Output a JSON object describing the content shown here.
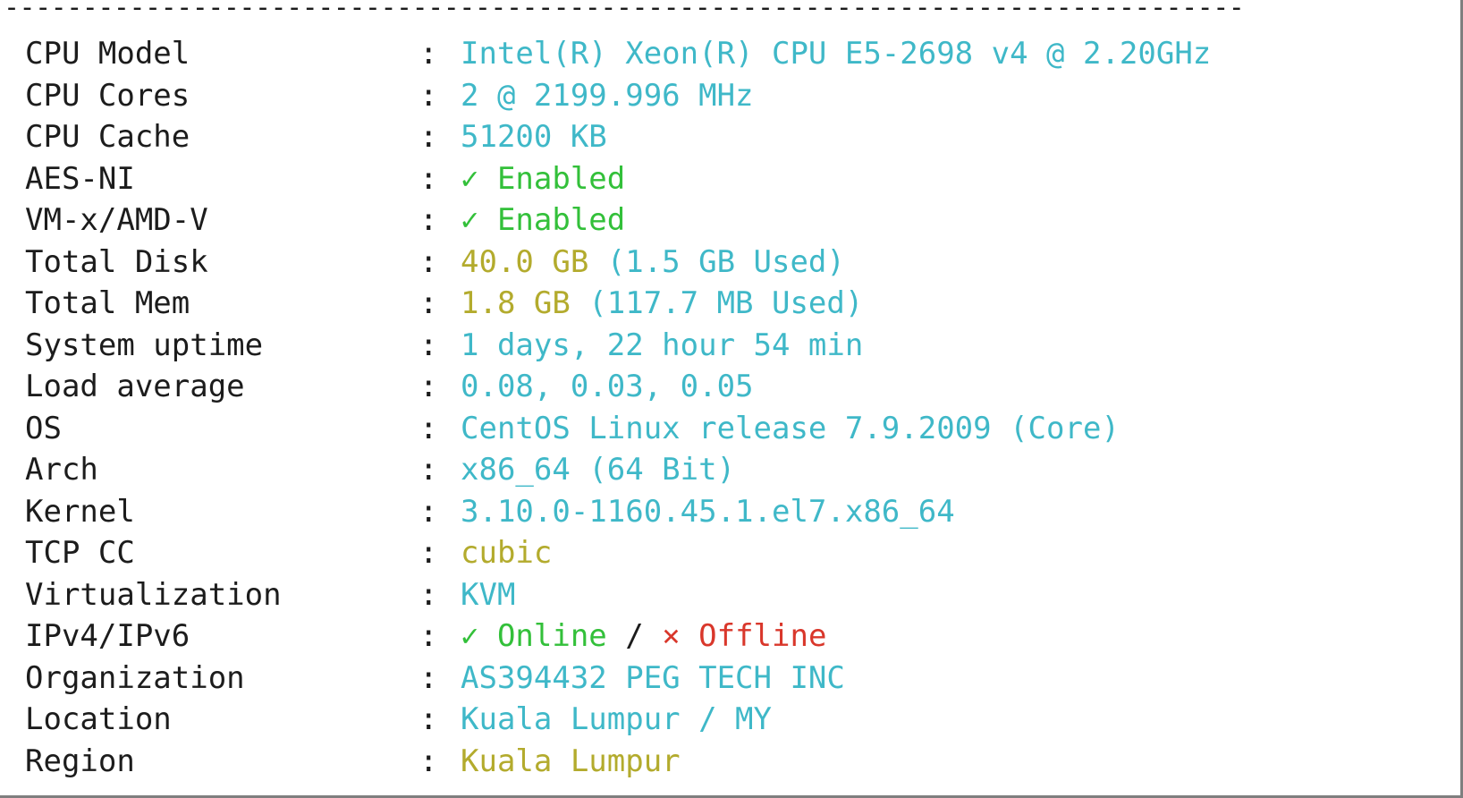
{
  "colors": {
    "label": "#1c1c1c",
    "cyan": "#3fb8c8",
    "green": "#33c03a",
    "yellow": "#b3ab2d",
    "red": "#d9372b",
    "plain": "#1c1c1c"
  },
  "separator": "-------------------------------------------------------------------------------",
  "rows": [
    {
      "label": "CPU Model",
      "colon": ":",
      "segments": [
        {
          "text": "Intel(R) Xeon(R) CPU E5-2698 v4 @ 2.20GHz",
          "color": "cyan"
        }
      ]
    },
    {
      "label": "CPU Cores",
      "colon": ":",
      "segments": [
        {
          "text": "2 @ 2199.996 MHz",
          "color": "cyan"
        }
      ]
    },
    {
      "label": "CPU Cache",
      "colon": ":",
      "segments": [
        {
          "text": "51200 KB",
          "color": "cyan"
        }
      ]
    },
    {
      "label": "AES-NI",
      "colon": ":",
      "segments": [
        {
          "text": "✓ Enabled",
          "color": "green"
        }
      ]
    },
    {
      "label": "VM-x/AMD-V",
      "colon": ":",
      "segments": [
        {
          "text": "✓ Enabled",
          "color": "green"
        }
      ]
    },
    {
      "label": "Total Disk",
      "colon": ":",
      "segments": [
        {
          "text": "40.0 GB ",
          "color": "yellow"
        },
        {
          "text": "(1.5 GB Used)",
          "color": "cyan"
        }
      ]
    },
    {
      "label": "Total Mem",
      "colon": ":",
      "segments": [
        {
          "text": "1.8 GB ",
          "color": "yellow"
        },
        {
          "text": "(117.7 MB Used)",
          "color": "cyan"
        }
      ]
    },
    {
      "label": "System uptime",
      "colon": ":",
      "segments": [
        {
          "text": "1 days, 22 hour 54 min",
          "color": "cyan"
        }
      ]
    },
    {
      "label": "Load average",
      "colon": ":",
      "segments": [
        {
          "text": "0.08, 0.03, 0.05",
          "color": "cyan"
        }
      ]
    },
    {
      "label": "OS",
      "colon": ":",
      "segments": [
        {
          "text": "CentOS Linux release 7.9.2009 (Core)",
          "color": "cyan"
        }
      ]
    },
    {
      "label": "Arch",
      "colon": ":",
      "segments": [
        {
          "text": "x86_64 (64 Bit)",
          "color": "cyan"
        }
      ]
    },
    {
      "label": "Kernel",
      "colon": ":",
      "segments": [
        {
          "text": "3.10.0-1160.45.1.el7.x86_64",
          "color": "cyan"
        }
      ]
    },
    {
      "label": "TCP CC",
      "colon": ":",
      "segments": [
        {
          "text": "cubic",
          "color": "yellow"
        }
      ]
    },
    {
      "label": "Virtualization",
      "colon": ":",
      "segments": [
        {
          "text": "KVM",
          "color": "cyan"
        }
      ]
    },
    {
      "label": "IPv4/IPv6",
      "colon": ":",
      "segments": [
        {
          "text": "✓ Online",
          "color": "green"
        },
        {
          "text": " / ",
          "color": "plain"
        },
        {
          "text": "× Offline",
          "color": "red"
        }
      ]
    },
    {
      "label": "Organization",
      "colon": ":",
      "segments": [
        {
          "text": "AS394432 PEG TECH INC",
          "color": "cyan"
        }
      ]
    },
    {
      "label": "Location",
      "colon": ":",
      "segments": [
        {
          "text": "Kuala Lumpur / MY",
          "color": "cyan"
        }
      ]
    },
    {
      "label": "Region",
      "colon": ":",
      "segments": [
        {
          "text": "Kuala Lumpur",
          "color": "yellow"
        }
      ]
    }
  ]
}
